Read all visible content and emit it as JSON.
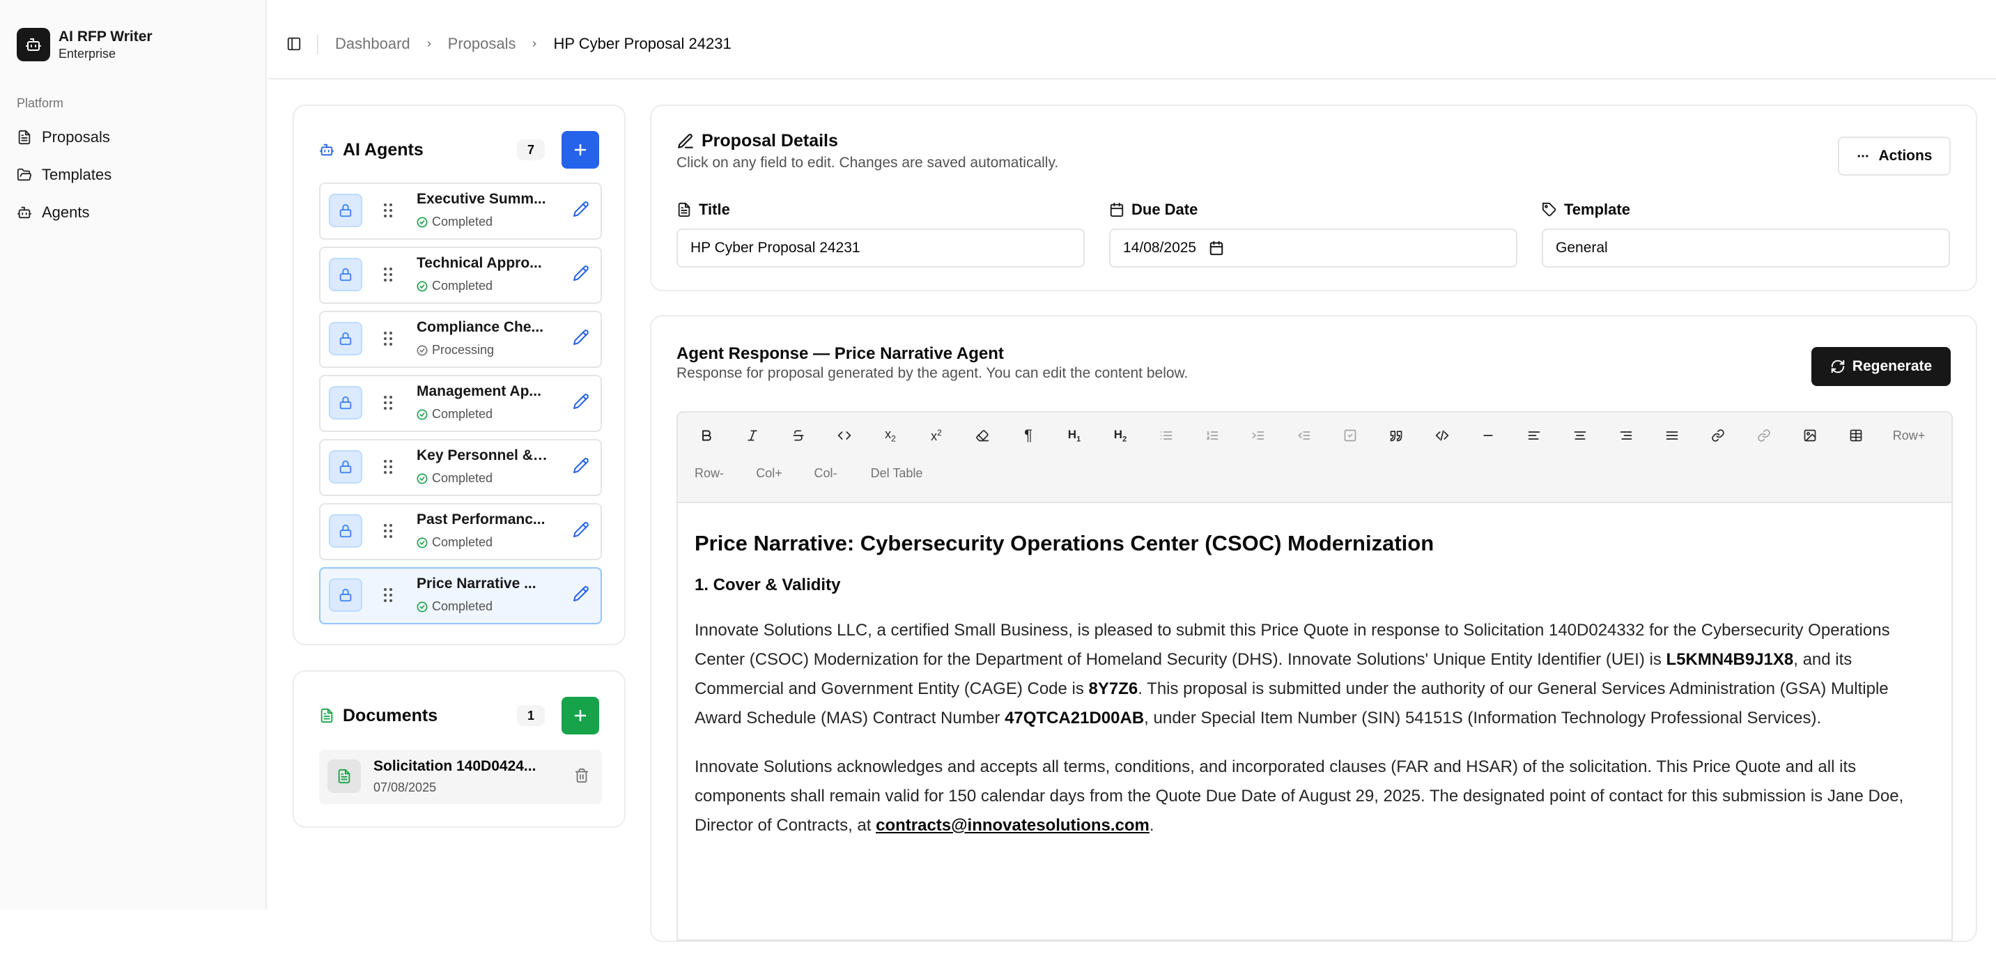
{
  "app": {
    "name": "AI RFP Writer",
    "plan": "Enterprise"
  },
  "sidebar": {
    "section_label": "Platform",
    "items": [
      {
        "label": "Proposals",
        "icon": "file-text-icon"
      },
      {
        "label": "Templates",
        "icon": "folder-icon"
      },
      {
        "label": "Agents",
        "icon": "bot-icon"
      }
    ]
  },
  "breadcrumb": {
    "items": [
      "Dashboard",
      "Proposals",
      "HP Cyber Proposal 24231"
    ]
  },
  "agents": {
    "title": "AI Agents",
    "count": "7",
    "items": [
      {
        "name": "Executive Summ...",
        "status": "Completed"
      },
      {
        "name": "Technical Appro...",
        "status": "Completed"
      },
      {
        "name": "Compliance Che...",
        "status": "Processing"
      },
      {
        "name": "Management Ap...",
        "status": "Completed"
      },
      {
        "name": "Key Personnel & ...",
        "status": "Completed"
      },
      {
        "name": "Past Performanc...",
        "status": "Completed"
      },
      {
        "name": "Price Narrative ...",
        "status": "Completed"
      }
    ]
  },
  "documents": {
    "title": "Documents",
    "count": "1",
    "items": [
      {
        "name": "Solicitation 140D0424...",
        "date": "07/08/2025"
      }
    ]
  },
  "details": {
    "title": "Proposal Details",
    "subtitle": "Click on any field to edit. Changes are saved automatically.",
    "actions_label": "Actions",
    "fields": {
      "title": {
        "label": "Title",
        "value": "HP Cyber Proposal 24231"
      },
      "due_date": {
        "label": "Due Date",
        "value": "14/08/2025"
      },
      "template": {
        "label": "Template",
        "value": "General"
      }
    }
  },
  "response": {
    "title": "Agent Response — Price Narrative Agent",
    "subtitle": "Response for proposal generated by the agent. You can edit the content below.",
    "regenerate_label": "Regenerate",
    "toolbar": {
      "text_buttons": [
        "Row+",
        "Row-",
        "Col+",
        "Col-",
        "Del Table"
      ]
    },
    "content": {
      "heading": "Price Narrative: Cybersecurity Operations Center (CSOC) Modernization",
      "section": "1. Cover & Validity",
      "p1": {
        "a": "Innovate Solutions LLC, a certified Small Business, is pleased to submit this Price Quote in response to Solicitation 140D024332 for the Cybersecurity Operations Center (CSOC) Modernization for the Department of Homeland Security (DHS). Innovate Solutions' Unique Entity Identifier (UEI) is ",
        "uei": "L5KMN4B9J1X8",
        "b": ", and its Commercial and Government Entity (CAGE) Code is ",
        "cage": "8Y7Z6",
        "c": ". This proposal is submitted under the authority of our General Services Administration (GSA) Multiple Award Schedule (MAS) Contract Number ",
        "contract": "47QTCA21D00AB",
        "d": ", under Special Item Number (SIN) 54151S (Information Technology Professional Services)."
      },
      "p2": {
        "a": "Innovate Solutions acknowledges and accepts all terms, conditions, and incorporated clauses (FAR and HSAR) of the solicitation. This Price Quote and all its components shall remain valid for 150 calendar days from the Quote Due Date of August 29, 2025. The designated point of contact for this submission is Jane Doe, Director of Contracts, at ",
        "email": "contracts@innovatesolutions.com",
        "b": "."
      }
    }
  },
  "colors": {
    "primary": "#2563eb",
    "success": "#16a34a",
    "dark": "#171717"
  }
}
